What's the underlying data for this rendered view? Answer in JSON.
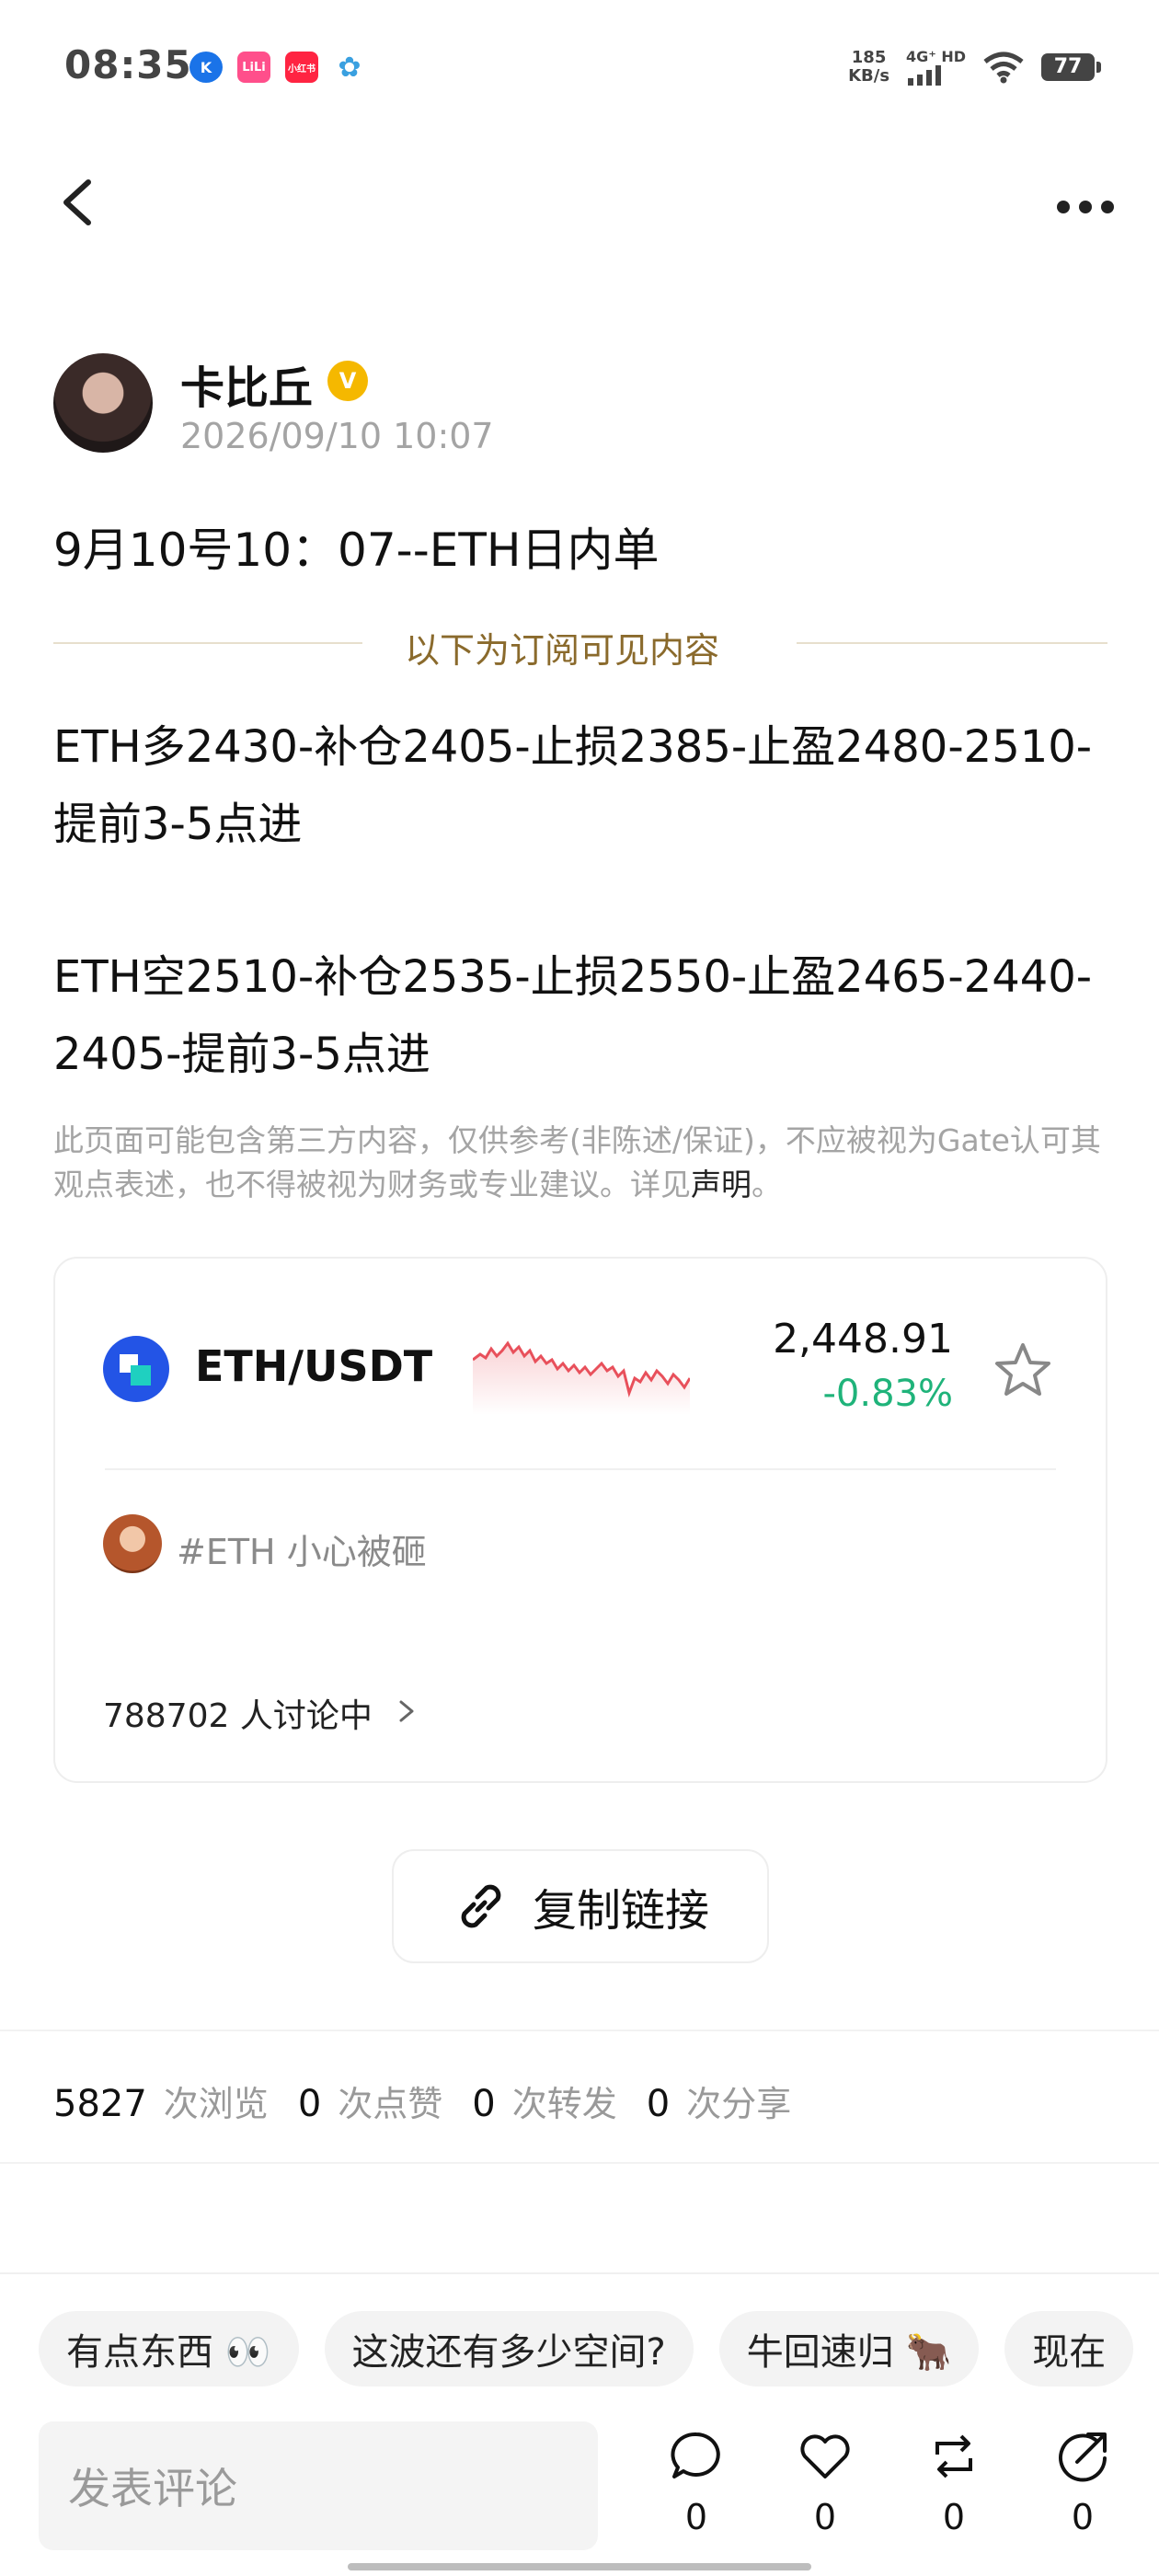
{
  "status_bar": {
    "time": "08:35",
    "apps": [
      {
        "icon": "k-app-icon",
        "label": "K",
        "color": "#1a73e8"
      },
      {
        "icon": "chat-app-icon",
        "label": "LiLi",
        "color": "#ff4f8b"
      },
      {
        "icon": "news-app-icon",
        "label": "小红书",
        "color": "#ff2442"
      },
      {
        "icon": "flower-app-icon",
        "label": "✿",
        "color": "#ffffff"
      }
    ],
    "net_speed_value": "185",
    "net_speed_unit": "KB/s",
    "signal_label": "4G⁺ HD",
    "battery": "77"
  },
  "header": {
    "back_icon": "chevron-left-icon",
    "more_icon": "more-horizontal-icon"
  },
  "post": {
    "author": "卡比丘",
    "verified_badge": "V",
    "time": "2026/09/10 10:07",
    "title": "9月10号10：07--ETH日内单",
    "subscribe_divider": "以下为订阅可见内容",
    "paragraphs": [
      "ETH多2430-补仓2405-止损2385-止盈2480-2510-提前3-5点进",
      "ETH空2510-补仓2535-止损2550-止盈2465-2440-2405-提前3-5点进"
    ],
    "disclaimer": "此页面可能包含第三方内容，仅供参考(非陈述/保证)，不应被视为Gate认可其观点表述，也不得被视为财务或专业建议。详见",
    "disclaimer_link": "声明",
    "disclaimer_end": "。"
  },
  "market_card": {
    "pair": "ETH/USDT",
    "price": "2,448.91",
    "change": "-0.83%",
    "change_color": "#1fb37a",
    "spark_color": "#e8505b",
    "topic": "#ETH 小心被砸",
    "discussion": "788702 人讨论中"
  },
  "copy_link": {
    "label": "复制链接"
  },
  "stats": {
    "views": "5827",
    "views_label": "次浏览",
    "likes": "0",
    "likes_label": "次点赞",
    "reposts": "0",
    "reposts_label": "次转发",
    "shares": "0",
    "shares_label": "次分享"
  },
  "quick_replies": [
    "有点东西 👀",
    "这波还有多少空间?",
    "牛回速归 🐂",
    "现在"
  ],
  "comment_bar": {
    "placeholder": "发表评论",
    "comment_count": "0",
    "like_count": "0",
    "repost_count": "0",
    "share_count": "0"
  }
}
